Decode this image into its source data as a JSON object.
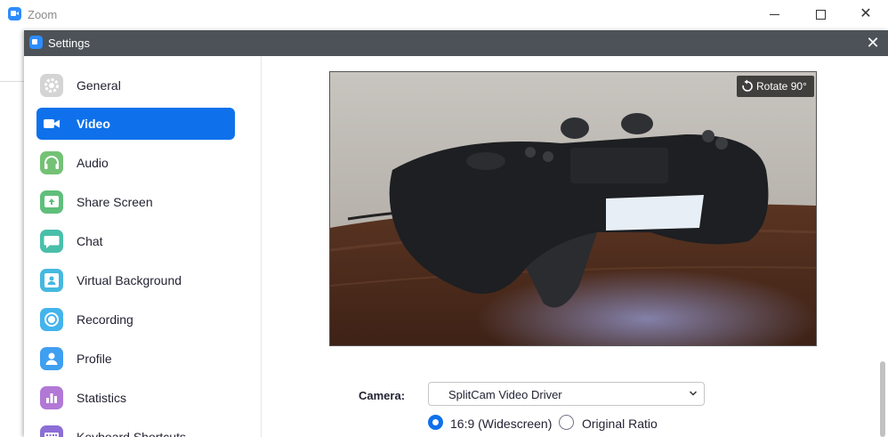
{
  "window": {
    "app_title": "Zoom"
  },
  "settings": {
    "title": "Settings",
    "sidebar": {
      "items": [
        {
          "label": "General",
          "icon": "gear-icon",
          "color": "#c9c9c9",
          "active": false
        },
        {
          "label": "Video",
          "icon": "video-camera-icon",
          "color": "#0e71eb",
          "active": true
        },
        {
          "label": "Audio",
          "icon": "headphones-icon",
          "color": "#73c275",
          "active": false
        },
        {
          "label": "Share Screen",
          "icon": "share-screen-icon",
          "color": "#5fbf7b",
          "active": false
        },
        {
          "label": "Chat",
          "icon": "chat-icon",
          "color": "#49bfa9",
          "active": false
        },
        {
          "label": "Virtual Background",
          "icon": "virtual-background-icon",
          "color": "#45b8e0",
          "active": false
        },
        {
          "label": "Recording",
          "icon": "recording-icon",
          "color": "#44b4ec",
          "active": false
        },
        {
          "label": "Profile",
          "icon": "profile-icon",
          "color": "#3f9ff0",
          "active": false
        },
        {
          "label": "Statistics",
          "icon": "statistics-icon",
          "color": "#b278d6",
          "active": false
        },
        {
          "label": "Keyboard Shortcuts",
          "icon": "keyboard-icon",
          "color": "#8c6ed6",
          "active": false
        }
      ]
    },
    "video": {
      "rotate_label": "Rotate 90°",
      "camera_label": "Camera:",
      "camera_value": "SplitCam Video Driver",
      "ratio_options": [
        {
          "label": "16:9 (Widescreen)",
          "selected": true
        },
        {
          "label": "Original Ratio",
          "selected": false
        }
      ]
    }
  }
}
